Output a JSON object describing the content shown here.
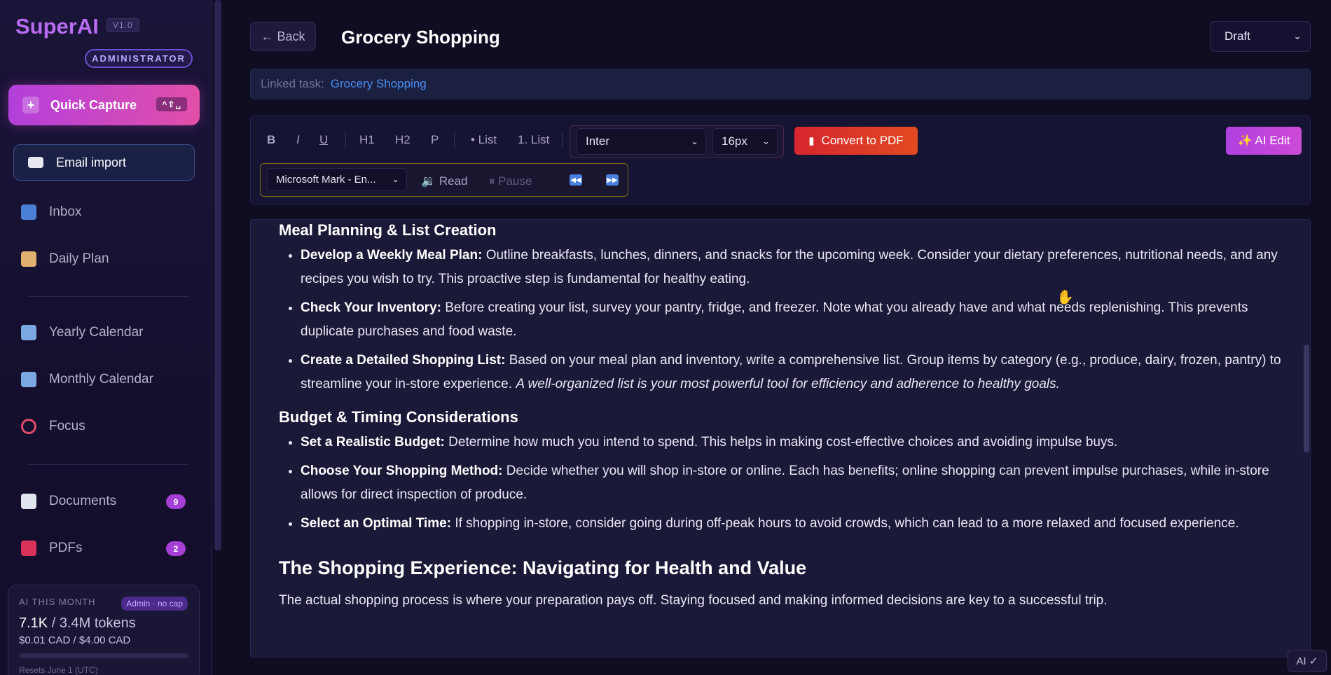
{
  "app": {
    "brand": "SuperAI",
    "version": "V1.0",
    "role_badge": "ADMINISTRATOR"
  },
  "sidebar": {
    "quick_capture": {
      "label": "Quick Capture",
      "shortcut": "^⇧␣"
    },
    "email_import": {
      "label": "Email import"
    },
    "items": [
      {
        "label": "Inbox",
        "icon": "inbox-icon"
      },
      {
        "label": "Daily Plan",
        "icon": "clipboard-icon"
      },
      {
        "label": "Yearly Calendar",
        "icon": "calendar-icon"
      },
      {
        "label": "Monthly Calendar",
        "icon": "calendar-icon"
      },
      {
        "label": "Focus",
        "icon": "target-icon"
      },
      {
        "label": "Documents",
        "icon": "document-icon",
        "count": "9"
      },
      {
        "label": "PDFs",
        "icon": "pdf-icon",
        "count": "2"
      }
    ],
    "usage": {
      "title": "AI THIS MONTH",
      "tag": "Admin · no cap",
      "tokens_used": "7.1K",
      "tokens_total": " / 3.4M tokens",
      "cost": "$0.01 CAD / $4.00 CAD",
      "reset": "Resets June 1 (UTC)"
    }
  },
  "header": {
    "back_label": "← Back",
    "title": "Grocery Shopping",
    "status": {
      "selected": "Draft",
      "options": [
        "Draft"
      ]
    }
  },
  "linked": {
    "label": "Linked task:",
    "value": "Grocery Shopping"
  },
  "toolbar": {
    "bold": "B",
    "italic": "I",
    "underline": "U",
    "h1": "H1",
    "h2": "H2",
    "p": "P",
    "bullet_list": "• List",
    "numbered_list": "1. List",
    "font": "Inter",
    "size": "16px",
    "convert_pdf": "Convert to PDF",
    "ai_edit": "✨ AI Edit",
    "voice": "Microsoft Mark - En...",
    "read": "Read",
    "pause": "Pause"
  },
  "document": {
    "sections": [
      {
        "heading": "Meal Planning & List Creation",
        "items": [
          {
            "term": "Develop a Weekly Meal Plan:",
            "text": " Outline breakfasts, lunches, dinners, and snacks for the upcoming week. Consider your dietary preferences, nutritional needs, and any recipes you wish to try. This proactive step is fundamental for healthy eating."
          },
          {
            "term": "Check Your Inventory:",
            "text": " Before creating your list, survey your pantry, fridge, and freezer. Note what you already have and what needs replenishing. This prevents duplicate purchases and food waste."
          },
          {
            "term": "Create a Detailed Shopping List:",
            "text": " Based on your meal plan and inventory, write a comprehensive list. Group items by category (e.g., produce, dairy, frozen, pantry) to streamline your in-store experience. ",
            "emphasis": "A well-organized list is your most powerful tool for efficiency and adherence to healthy goals."
          }
        ]
      },
      {
        "heading": "Budget & Timing Considerations",
        "items": [
          {
            "term": "Set a Realistic Budget:",
            "text": " Determine how much you intend to spend. This helps in making cost-effective choices and avoiding impulse buys."
          },
          {
            "term": "Choose Your Shopping Method:",
            "text": " Decide whether you will shop in-store or online. Each has benefits; online shopping can prevent impulse purchases, while in-store allows for direct inspection of produce."
          },
          {
            "term": "Select an Optimal Time:",
            "text": " If shopping in-store, consider going during off-peak hours to avoid crowds, which can lead to a more relaxed and focused experience."
          }
        ]
      }
    ],
    "main_heading": "The Shopping Experience: Navigating for Health and Value",
    "paragraph": "The actual shopping process is where your preparation pays off. Staying focused and making informed decisions are key to a successful trip."
  },
  "ai_status": "AI ✓"
}
